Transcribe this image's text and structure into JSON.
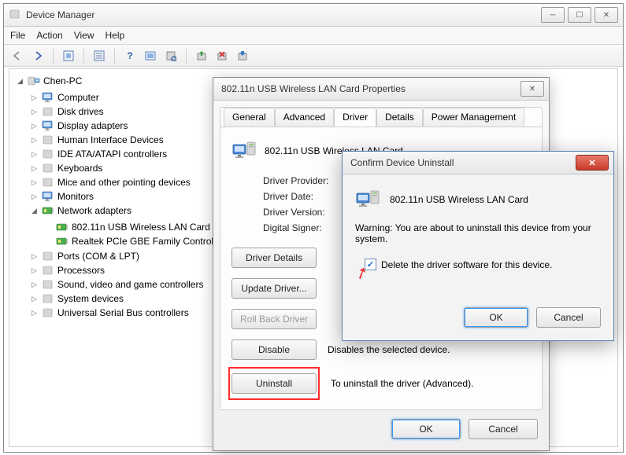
{
  "main_window": {
    "title": "Device Manager",
    "menus": {
      "file": "File",
      "action": "Action",
      "view": "View",
      "help": "Help"
    },
    "root_node": "Chen-PC",
    "nodes": {
      "computer": "Computer",
      "disk_drives": "Disk drives",
      "display_adapters": "Display adapters",
      "hid": "Human Interface Devices",
      "ide": "IDE ATA/ATAPI controllers",
      "keyboards": "Keyboards",
      "mice": "Mice and other pointing devices",
      "monitors": "Monitors",
      "network_adapters": "Network adapters",
      "na_child1": "802.11n USB Wireless LAN Card",
      "na_child2": "Realtek PCIe GBE Family Controller",
      "ports": "Ports (COM & LPT)",
      "processors": "Processors",
      "sound": "Sound, video and game controllers",
      "system_devices": "System devices",
      "usb": "Universal Serial Bus controllers"
    }
  },
  "properties": {
    "title": "802.11n USB Wireless LAN Card Properties",
    "tabs": {
      "general": "General",
      "advanced": "Advanced",
      "driver": "Driver",
      "details": "Details",
      "power": "Power Management"
    },
    "device_name": "802.11n USB Wireless LAN Card",
    "kv": {
      "provider_label": "Driver Provider:",
      "date_label": "Driver Date:",
      "version_label": "Driver Version:",
      "signer_label": "Digital Signer:"
    },
    "buttons": {
      "driver_details": "Driver Details",
      "update_driver": "Update Driver...",
      "roll_back": "Roll Back Driver",
      "disable": "Disable",
      "uninstall": "Uninstall",
      "ok": "OK",
      "cancel": "Cancel"
    },
    "descriptions": {
      "disable": "Disables the selected device.",
      "uninstall": "To uninstall the driver (Advanced)."
    }
  },
  "confirm": {
    "title": "Confirm Device Uninstall",
    "device_name": "802.11n USB Wireless LAN Card",
    "warning": "Warning: You are about to uninstall this device from your system.",
    "checkbox_label": "Delete the driver software for this device.",
    "ok": "OK",
    "cancel": "Cancel"
  }
}
